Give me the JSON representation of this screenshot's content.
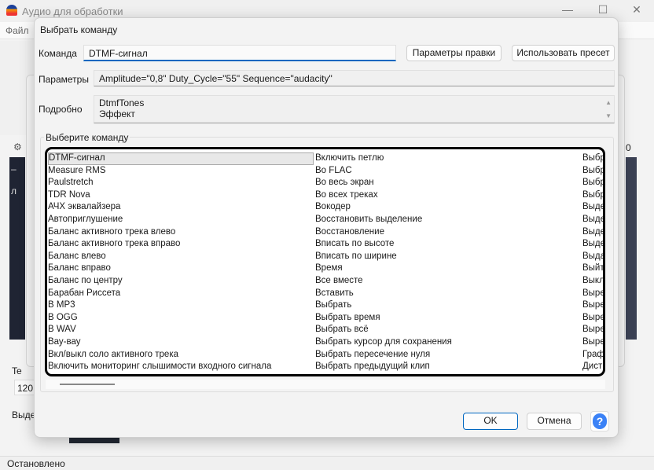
{
  "app": {
    "title": "Аудио для обработки",
    "menu_file": "Файл",
    "status": "Остановлено",
    "bg_label_te": "Te",
    "bg_value": "120",
    "bg_label_vyde": "Выде",
    "bg_marker_0": "0",
    "bg_track_minus": "–",
    "bg_track_l": "л"
  },
  "dialog": {
    "title": "Выбрать команду",
    "command_label": "Команда",
    "command_value": "DTMF-сигнал",
    "edit_params_button": "Параметры правки",
    "use_preset_button": "Использовать пресет",
    "params_label": "Параметры",
    "params_value": "Amplitude=\"0,8\" Duty_Cycle=\"55\" Sequence=\"audacity\"",
    "details_label": "Подробно",
    "details_lines": [
      "DtmfTones",
      "Эффект"
    ],
    "group_label": "Выберите команду",
    "list": {
      "col1": [
        "DTMF-сигнал",
        "Measure RMS",
        "Paulstretch",
        "TDR Nova",
        "АЧХ эквалайзера",
        "Автоприглушение",
        "Баланс активного трека влево",
        "Баланс активного трека вправо",
        "Баланс влево",
        "Баланс вправо",
        "Баланс по центру",
        "Барабан Риссета",
        "В MP3",
        "В OGG",
        "В WAV",
        "Вау-вау",
        "Вкл/выкл соло активного трека",
        "Включить мониторинг слышимости входного сигнала"
      ],
      "col2": [
        "Включить петлю",
        "Во FLAC",
        "Во весь экран",
        "Во всех треках",
        "Вокодер",
        "Восстановить выделение",
        "Восстановление",
        "Вписать по высоте",
        "Вписать по ширине",
        "Время",
        "Все вместе",
        "Вставить",
        "Выбрать",
        "Выбрать время",
        "Выбрать всё",
        "Выбрать курсор для сохранения",
        "Выбрать пересечение нуля",
        "Выбрать предыдущий клип"
      ],
      "col3": [
        "Выбр",
        "Выбр",
        "Выбр",
        "Выбр",
        "Выде",
        "Выде",
        "Выде",
        "Выде",
        "Выда",
        "Выйт",
        "Выкл",
        "Выре",
        "Выре",
        "Выре",
        "Выре",
        "Выре",
        "Граф",
        "Дист"
      ]
    },
    "ok_button": "OK",
    "cancel_button": "Отмена",
    "help_button": "?"
  },
  "colors": {
    "accent": "#0067c0",
    "help": "#3b82f6",
    "highlight_border": "#000000"
  }
}
